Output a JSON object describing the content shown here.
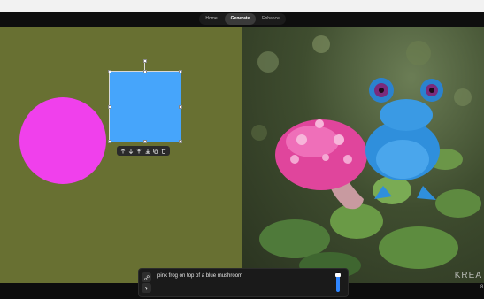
{
  "nav": {
    "tabs": [
      {
        "label": "Home",
        "active": false
      },
      {
        "label": "Generate",
        "active": true
      },
      {
        "label": "Enhance",
        "active": false
      }
    ]
  },
  "canvas": {
    "background_color": "#687032",
    "shapes": [
      {
        "kind": "circle",
        "color": "#f040ec"
      },
      {
        "kind": "square",
        "color": "#46a5fb",
        "selected": true
      }
    ],
    "toolbar": [
      "arrow-up-icon",
      "arrow-down-icon",
      "bring-to-front-icon",
      "send-to-back-icon",
      "duplicate-icon",
      "trash-icon"
    ]
  },
  "preview": {
    "description_icons": [
      "frog",
      "mushroom"
    ],
    "watermark": "KREA"
  },
  "prompt": {
    "text": "pink frog on top of a blue mushroom",
    "strength": 0.85,
    "accent_color": "#2f86ff"
  },
  "edge_label": "8"
}
